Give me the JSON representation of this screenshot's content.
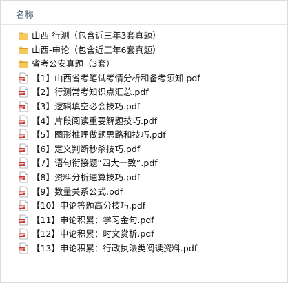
{
  "header": {
    "column_name": "名称"
  },
  "items": [
    {
      "type": "folder",
      "name": "山西-行测（包含近三年3套真题）"
    },
    {
      "type": "folder",
      "name": "山西-申论（包含近三年6套真题）"
    },
    {
      "type": "folder",
      "name": "省考公安真题（3套）"
    },
    {
      "type": "pdf",
      "name": "【1】山西省考笔试考情分析和备考须知.pdf"
    },
    {
      "type": "pdf",
      "name": "【2】行测常考知识点汇总.pdf"
    },
    {
      "type": "pdf",
      "name": "【3】逻辑填空必会技巧.pdf"
    },
    {
      "type": "pdf",
      "name": "【4】片段阅读重要解题技巧.pdf"
    },
    {
      "type": "pdf",
      "name": "【5】图形推理做题思路和技巧.pdf"
    },
    {
      "type": "pdf",
      "name": "【6】定义判断秒杀技巧.pdf"
    },
    {
      "type": "pdf",
      "name": "【7】语句衔接题“四大一致”.pdf"
    },
    {
      "type": "pdf",
      "name": "【8】资料分析速算技巧.pdf"
    },
    {
      "type": "pdf",
      "name": "【9】数量关系公式.pdf"
    },
    {
      "type": "pdf",
      "name": "【10】申论答题高分技巧.pdf"
    },
    {
      "type": "pdf",
      "name": "【11】申论积累：学习金句.pdf"
    },
    {
      "type": "pdf",
      "name": "【12】申论积累：时文赏析.pdf"
    },
    {
      "type": "pdf",
      "name": "【13】申论积累：行政执法类阅读资料.pdf"
    }
  ],
  "colors": {
    "folder_yellow": "#f2c14e",
    "pdf_red": "#c8382f"
  }
}
